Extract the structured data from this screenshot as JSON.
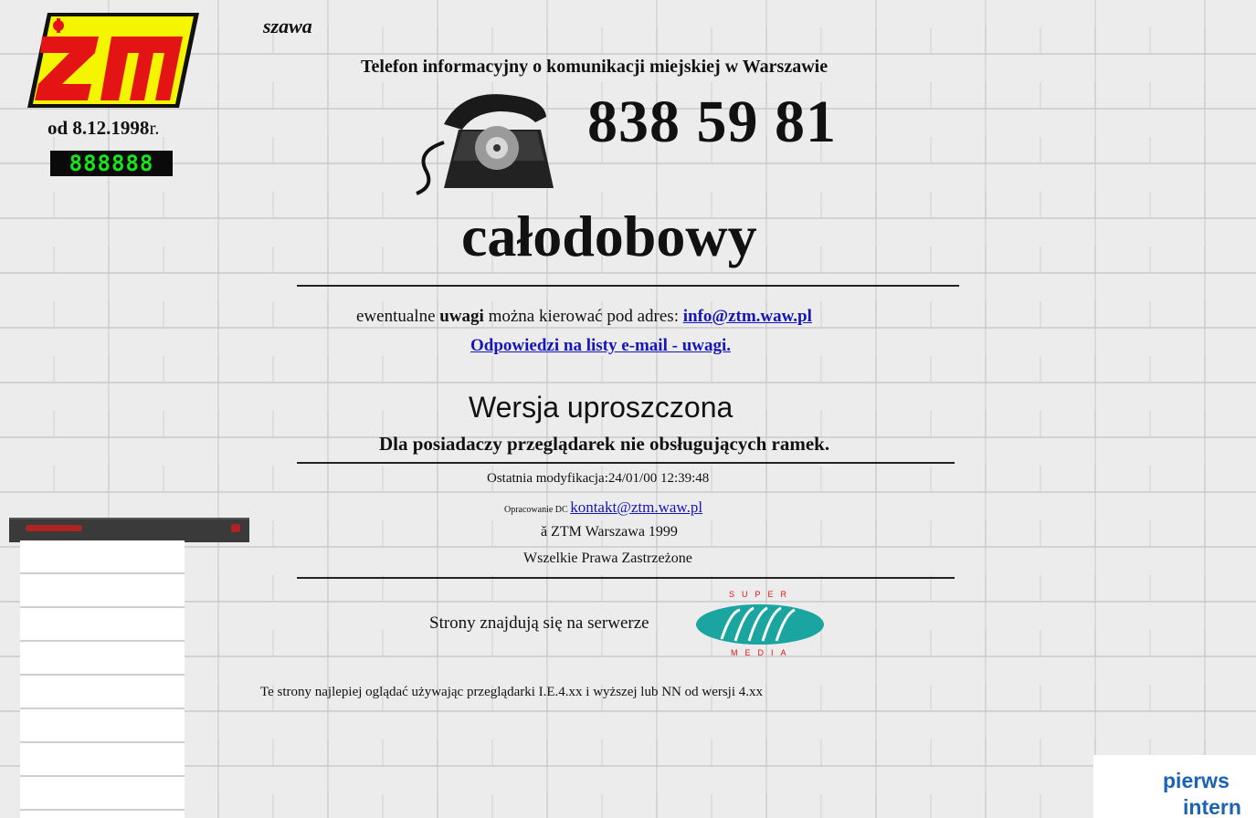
{
  "header": {
    "city_fragment": "szawa",
    "since_prefix": "od 8.12.1998",
    "since_suffix": "r.",
    "counter": "888888",
    "logo_text": "ZTM"
  },
  "phone": {
    "title": "Telefon informacyjny o komunikacji miejskiej w Warszawie",
    "number": "838 59 81",
    "hours": "całodobowy"
  },
  "contact": {
    "remarks_pre": "ewentualne ",
    "remarks_bold": "uwagi",
    "remarks_post": " można kierować pod adres: ",
    "email": "info@ztm.waw.pl",
    "answers_link": "Odpowiedzi na listy e-mail - uwagi."
  },
  "simple_version": {
    "title": "Wersja uproszczona",
    "subtitle": "Dla posiadaczy przeglądarek nie obsługujących ramek."
  },
  "footer": {
    "modified": "Ostatnia modyfikacja:24/01/00 12:39:48",
    "prepared_label": "Opracowanie DC ",
    "prepared_email": "kontakt@ztm.waw.pl",
    "copyright": "ă ZTM Warszawa 1999",
    "rights": "Wszelkie Prawa Zastrzeżone",
    "server_text": "Strony znajdują się na serwerze",
    "server_logo_top": "SUPER",
    "server_logo_bottom": "MEDIA",
    "browser_note": "Te strony najlepiej oglądać używając przeglądarki I.E.4.xx i wyższej lub NN od wersji 4.xx"
  },
  "corner": {
    "line1": "pierws",
    "line2": "intern"
  },
  "colors": {
    "link": "#1515b8",
    "logo_red": "#e41414",
    "logo_yellow": "#f5f500",
    "counter_green": "#19e319",
    "corner_blue": "#1a63b5"
  }
}
